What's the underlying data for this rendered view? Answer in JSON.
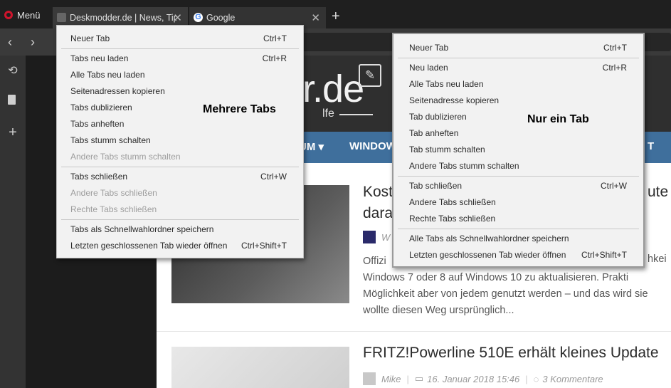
{
  "browser": {
    "menu_label": "Menü",
    "tabs": [
      {
        "title": "Deskmodder.de | News, Tip"
      },
      {
        "title": "Google",
        "favicon_letter": "G"
      }
    ],
    "new_tab_symbol": "+",
    "close_symbol": "✕",
    "back_symbol": "‹",
    "forward_symbol": "›"
  },
  "sidebar": {
    "icons": [
      "history-icon",
      "document-icon",
      "plus-icon"
    ],
    "add_symbol": "+"
  },
  "website": {
    "logo_text": "er.de",
    "logo_sub": "lfe",
    "nav_items": [
      "UM ▾",
      "WINDOW",
      "T"
    ],
    "articles": [
      {
        "title_line1": "Kost",
        "title_line1_right": "ute",
        "title_line2": "dara",
        "author_fragment": "W",
        "excerpt": [
          "Offizi",
          "Windows 7 oder 8 auf Windows 10 zu aktualisieren. Prakti",
          "Möglichkeit aber von jedem genutzt werden – und das wird sie",
          "wollte diesen Weg ursprünglich..."
        ],
        "excerpt_right": "hkei"
      },
      {
        "title": "FRITZ!Powerline 510E erhält kleines Update",
        "author": "Mike",
        "date": "16. Januar 2018 15:46",
        "comments": "3 Kommentare"
      }
    ]
  },
  "context_menu_multi": {
    "callout": "Mehrere Tabs",
    "groups": [
      [
        {
          "label": "Neuer Tab",
          "shortcut": "Ctrl+T",
          "enabled": true
        }
      ],
      [
        {
          "label": "Tabs neu laden",
          "shortcut": "Ctrl+R",
          "enabled": true
        },
        {
          "label": "Alle Tabs neu laden",
          "shortcut": "",
          "enabled": true
        },
        {
          "label": "Seitenadressen kopieren",
          "shortcut": "",
          "enabled": true
        },
        {
          "label": "Tabs dublizieren",
          "shortcut": "",
          "enabled": true
        },
        {
          "label": "Tabs anheften",
          "shortcut": "",
          "enabled": true
        },
        {
          "label": "Tabs stumm schalten",
          "shortcut": "",
          "enabled": true
        },
        {
          "label": "Andere Tabs stumm schalten",
          "shortcut": "",
          "enabled": false
        }
      ],
      [
        {
          "label": "Tabs schließen",
          "shortcut": "Ctrl+W",
          "enabled": true
        },
        {
          "label": "Andere Tabs schließen",
          "shortcut": "",
          "enabled": false
        },
        {
          "label": "Rechte Tabs schließen",
          "shortcut": "",
          "enabled": false
        }
      ],
      [
        {
          "label": "Tabs als Schnellwahlordner speichern",
          "shortcut": "",
          "enabled": true
        },
        {
          "label": "Letzten geschlossenen Tab wieder öffnen",
          "shortcut": "Ctrl+Shift+T",
          "enabled": true
        }
      ]
    ]
  },
  "context_menu_single": {
    "callout": "Nur ein Tab",
    "groups": [
      [
        {
          "label": "Neuer Tab",
          "shortcut": "Ctrl+T",
          "enabled": true
        }
      ],
      [
        {
          "label": "Neu laden",
          "shortcut": "Ctrl+R",
          "enabled": true
        },
        {
          "label": "Alle Tabs neu laden",
          "shortcut": "",
          "enabled": true
        },
        {
          "label": "Seitenadresse kopieren",
          "shortcut": "",
          "enabled": true
        },
        {
          "label": "Tab dublizieren",
          "shortcut": "",
          "enabled": true
        },
        {
          "label": "Tab anheften",
          "shortcut": "",
          "enabled": true
        },
        {
          "label": "Tab stumm schalten",
          "shortcut": "",
          "enabled": true
        },
        {
          "label": "Andere Tabs stumm schalten",
          "shortcut": "",
          "enabled": true
        }
      ],
      [
        {
          "label": "Tab schließen",
          "shortcut": "Ctrl+W",
          "enabled": true
        },
        {
          "label": "Andere Tabs schließen",
          "shortcut": "",
          "enabled": true
        },
        {
          "label": "Rechte Tabs schließen",
          "shortcut": "",
          "enabled": true
        }
      ],
      [
        {
          "label": "Alle Tabs als Schnellwahlordner speichern",
          "shortcut": "",
          "enabled": true
        },
        {
          "label": "Letzten geschlossenen Tab wieder öffnen",
          "shortcut": "Ctrl+Shift+T",
          "enabled": true
        }
      ]
    ]
  },
  "colors": {
    "opera_red": "#d0142c",
    "nav_blue": "#3f6f9c",
    "menu_bg": "#f2f2f2",
    "disabled_text": "#9d9d9d"
  }
}
